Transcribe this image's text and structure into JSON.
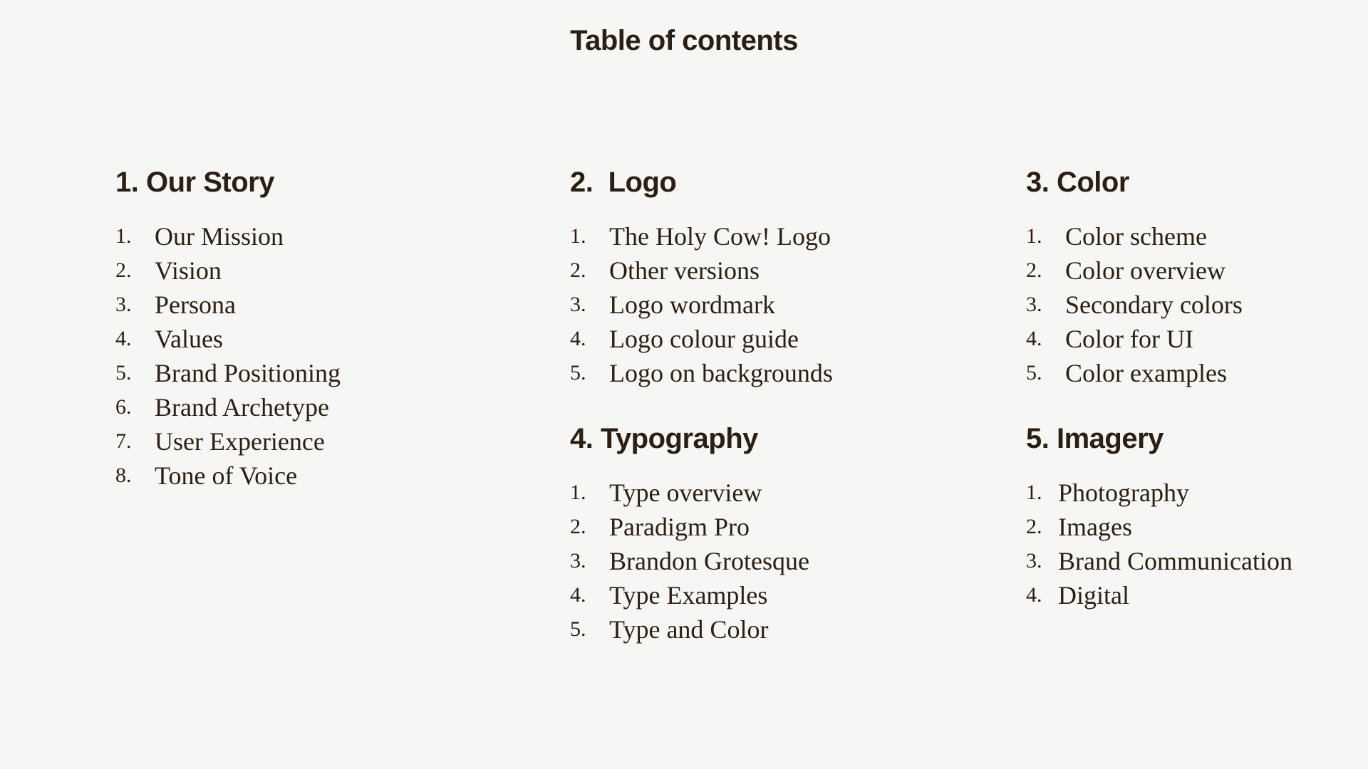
{
  "title": "Table of contents",
  "sections": {
    "story": {
      "heading": "1. Our Story",
      "items": [
        {
          "num": "1.",
          "label": "Our Mission"
        },
        {
          "num": "2.",
          "label": "Vision"
        },
        {
          "num": "3.",
          "label": "Persona"
        },
        {
          "num": "4.",
          "label": "Values"
        },
        {
          "num": "5.",
          "label": "Brand Positioning"
        },
        {
          "num": "6.",
          "label": "Brand Archetype"
        },
        {
          "num": "7.",
          "label": "User Experience"
        },
        {
          "num": "8.",
          "label": "Tone of Voice"
        }
      ]
    },
    "logo": {
      "heading": "2.  Logo",
      "items": [
        {
          "num": "1.",
          "label": "The Holy Cow! Logo"
        },
        {
          "num": "2.",
          "label": "Other versions"
        },
        {
          "num": "3.",
          "label": "Logo wordmark"
        },
        {
          "num": "4.",
          "label": "Logo colour guide"
        },
        {
          "num": "5.",
          "label": "Logo on backgrounds"
        }
      ]
    },
    "color": {
      "heading": "3. Color",
      "items": [
        {
          "num": "1.",
          "label": "Color scheme"
        },
        {
          "num": "2.",
          "label": "Color overview"
        },
        {
          "num": "3.",
          "label": "Secondary colors"
        },
        {
          "num": "4.",
          "label": "Color for UI"
        },
        {
          "num": "5.",
          "label": "Color examples"
        }
      ]
    },
    "typography": {
      "heading": "4. Typography",
      "items": [
        {
          "num": "1.",
          "label": "Type overview"
        },
        {
          "num": "2.",
          "label": "Paradigm Pro"
        },
        {
          "num": "3.",
          "label": "Brandon Grotesque"
        },
        {
          "num": "4.",
          "label": "Type Examples"
        },
        {
          "num": "5.",
          "label": "Type and Color"
        }
      ]
    },
    "imagery": {
      "heading": "5. Imagery",
      "items": [
        {
          "num": "1.",
          "label": "Photography"
        },
        {
          "num": "2.",
          "label": "Images"
        },
        {
          "num": "3.",
          "label": "Brand Communication"
        },
        {
          "num": "4.",
          "label": "Digital"
        }
      ]
    }
  },
  "colors": {
    "background": "#f6f6f4",
    "text": "#2a1f12"
  }
}
